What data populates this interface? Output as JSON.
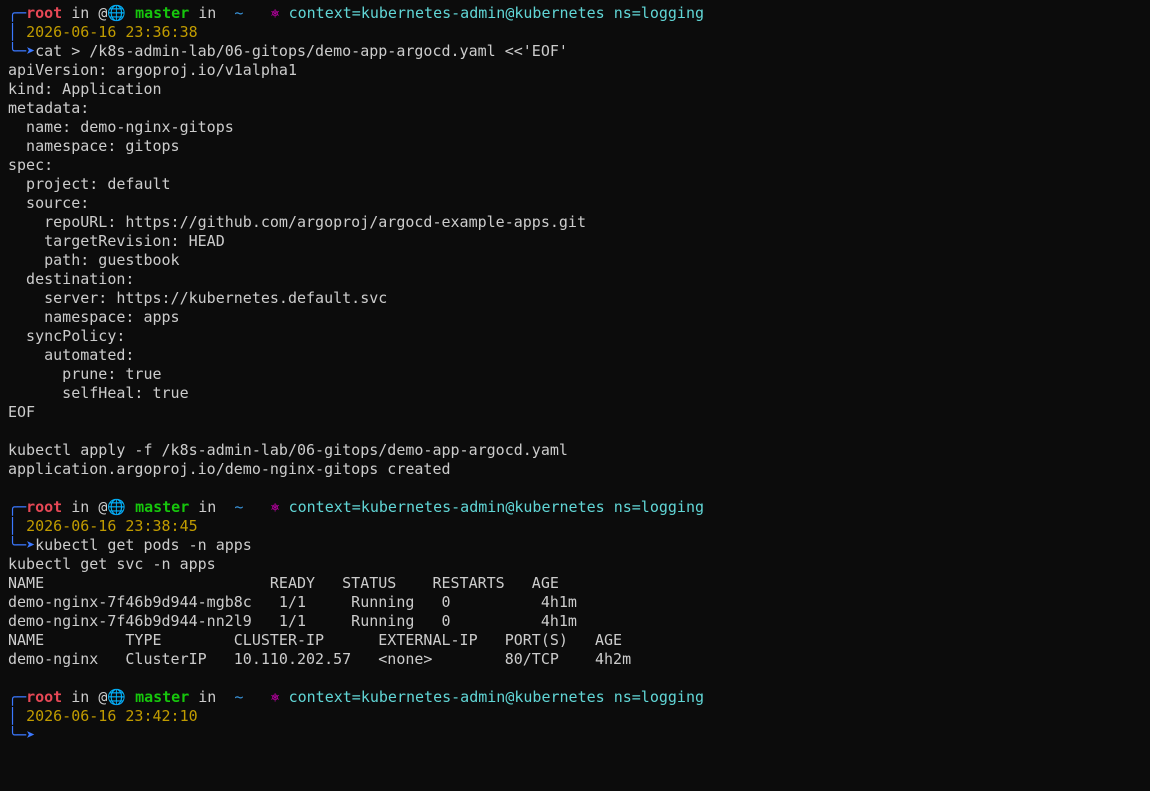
{
  "prompt": {
    "user": "root",
    "in_word": "in",
    "at_symbol": "@",
    "globe_glyph": "🌐",
    "branch": "master",
    "in_word2": "in",
    "tilde": "~",
    "k8s_glyph": "⎈",
    "context": "context=kubernetes-admin@kubernetes ns=logging",
    "corner_top": "╭─",
    "corner_mid": "│ ",
    "corner_bot": "╰─",
    "arrow": "➤"
  },
  "blocks": [
    {
      "timestamp": "2026-06-16 23:36:38",
      "command": "cat > /k8s-admin-lab/06-gitops/demo-app-argocd.yaml <<'EOF'",
      "output": [
        "apiVersion: argoproj.io/v1alpha1",
        "kind: Application",
        "metadata:",
        "  name: demo-nginx-gitops",
        "  namespace: gitops",
        "spec:",
        "  project: default",
        "  source:",
        "    repoURL: https://github.com/argoproj/argocd-example-apps.git",
        "    targetRevision: HEAD",
        "    path: guestbook",
        "  destination:",
        "    server: https://kubernetes.default.svc",
        "    namespace: apps",
        "  syncPolicy:",
        "    automated:",
        "      prune: true",
        "      selfHeal: true",
        "EOF",
        "",
        "kubectl apply -f /k8s-admin-lab/06-gitops/demo-app-argocd.yaml",
        "application.argoproj.io/demo-nginx-gitops created",
        ""
      ]
    },
    {
      "timestamp": "2026-06-16 23:38:45",
      "command": "kubectl get pods -n apps",
      "output": [
        "kubectl get svc -n apps",
        "NAME                         READY   STATUS    RESTARTS   AGE",
        "demo-nginx-7f46b9d944-mgb8c   1/1     Running   0          4h1m",
        "demo-nginx-7f46b9d944-nn2l9   1/1     Running   0          4h1m",
        "NAME         TYPE        CLUSTER-IP      EXTERNAL-IP   PORT(S)   AGE",
        "demo-nginx   ClusterIP   10.110.202.57   <none>        80/TCP    4h2m",
        ""
      ]
    },
    {
      "timestamp": "2026-06-16 23:42:10",
      "command": "",
      "output": []
    }
  ]
}
